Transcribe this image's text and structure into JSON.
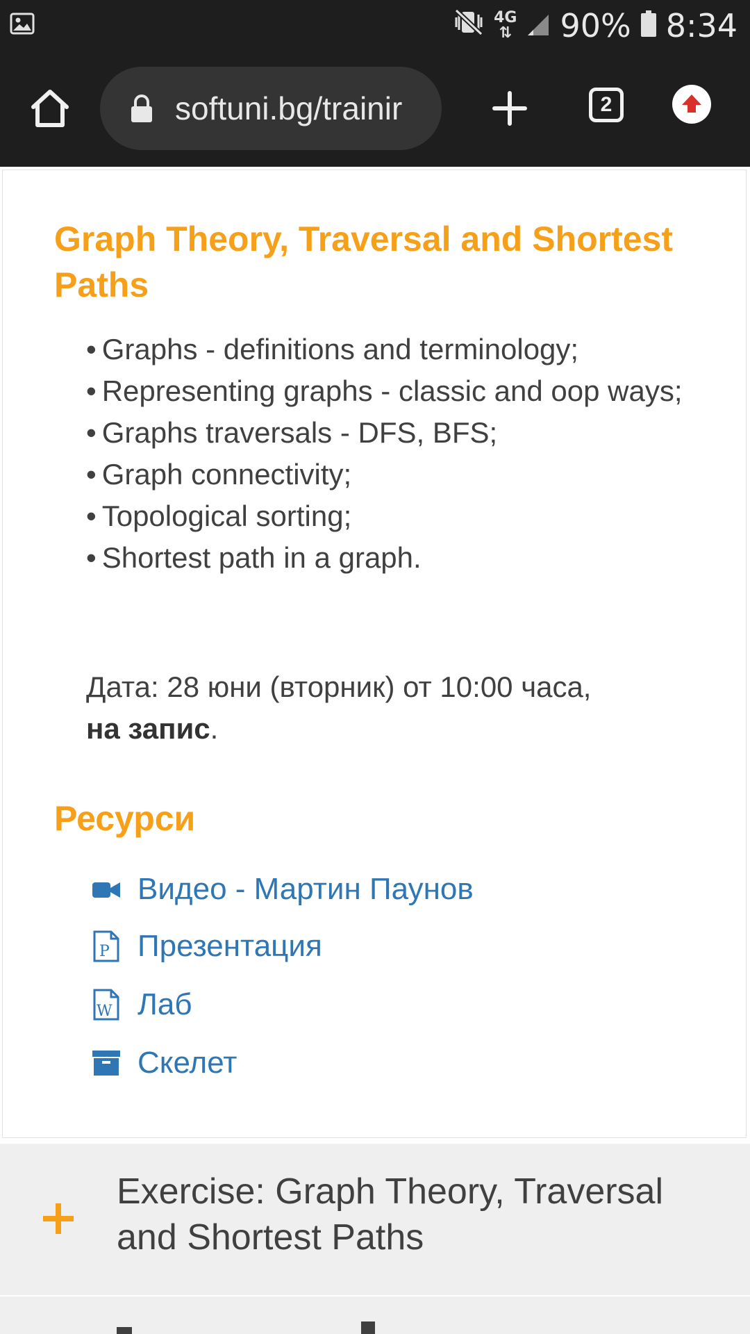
{
  "status_bar": {
    "battery": "90%",
    "time": "8:34",
    "network": "4G",
    "icons": [
      "image-icon",
      "mute-vibrate-icon",
      "data-arrows-icon",
      "signal-icon",
      "battery-icon"
    ]
  },
  "browser": {
    "url": "softuni.bg/trainir",
    "tab_count": "2",
    "icons": [
      "home-icon",
      "lock-icon",
      "plus-icon",
      "tabs-icon",
      "update-icon"
    ]
  },
  "lesson": {
    "title": "Graph Theory, Traversal and Shortest Paths",
    "topics": [
      "Graphs - definitions and terminology;",
      "Representing graphs - classic and oop ways;",
      "Graphs traversals - DFS, BFS;",
      "Graph connectivity;",
      "Topological sorting;",
      "Shortest path in a graph."
    ],
    "date_text": "Дата: 28 юни (вторник) от 10:00 часа,",
    "date_bold": "на запис",
    "date_end": "."
  },
  "resources": {
    "heading": "Ресурси",
    "items": [
      {
        "label": "Видео - Мартин Паунов",
        "icon": "video-camera-icon"
      },
      {
        "label": "Презентация",
        "icon": "powerpoint-file-icon"
      },
      {
        "label": "Лаб",
        "icon": "word-file-icon"
      },
      {
        "label": "Скелет",
        "icon": "archive-box-icon"
      }
    ]
  },
  "accordion": {
    "item_title": "Exercise: Graph Theory, Traversal and Shortest Paths",
    "icon": "plus-icon"
  },
  "colors": {
    "accent_orange": "#f6a01a",
    "link_blue": "#2f76b4",
    "text": "#404040",
    "bar_bg": "#1e1e1e"
  }
}
